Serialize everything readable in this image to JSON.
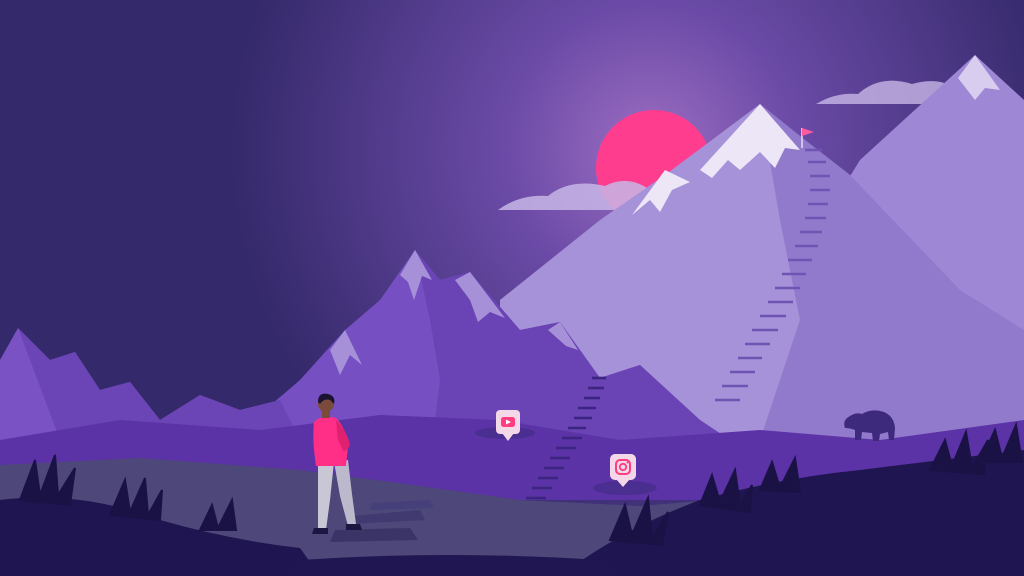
{
  "scene": {
    "colors": {
      "sky_top": "#3b2c6f",
      "sky_glow": "#8a5fb8",
      "sun": "#ff3d8f",
      "cloud": "#c7b6e6",
      "mountain_far": "#a48fd6",
      "mountain_mid": "#7a52c4",
      "mountain_near": "#5e34a8",
      "snow": "#ece6f7",
      "ground_path": "#52507e",
      "foreground": "#1f1550",
      "person_shirt": "#ff2e87",
      "person_pants": "#c9c6d6",
      "bear": "#3e2a7c",
      "flag": "#ff5aa0"
    },
    "icons": [
      "youtube-icon",
      "instagram-icon",
      "summit-flag-icon",
      "bear-silhouette",
      "hiker-figure"
    ]
  }
}
